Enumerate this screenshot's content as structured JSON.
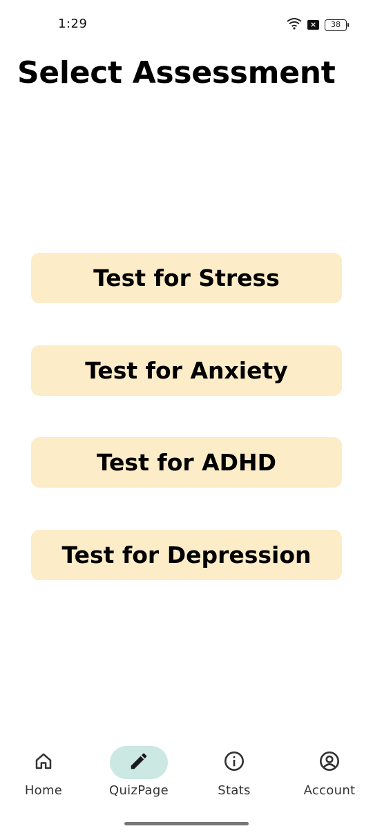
{
  "status_bar": {
    "time": "1:29",
    "battery_level": "38",
    "icons": [
      "wifi-icon",
      "notification-x-icon",
      "battery-icon"
    ]
  },
  "page": {
    "title": "Select Assessment"
  },
  "assessments": [
    {
      "label": "Test for Stress"
    },
    {
      "label": "Test for Anxiety"
    },
    {
      "label": "Test for ADHD"
    },
    {
      "label": "Test for Depression"
    }
  ],
  "nav": {
    "items": [
      {
        "label": "Home",
        "icon": "home-icon",
        "active": false
      },
      {
        "label": "QuizPage",
        "icon": "pencil-icon",
        "active": true
      },
      {
        "label": "Stats",
        "icon": "info-icon",
        "active": false
      },
      {
        "label": "Account",
        "icon": "account-circle-icon",
        "active": false
      }
    ]
  },
  "colors": {
    "button_bg": "#fcecc7",
    "nav_active_bg": "#cce8e2",
    "text": "#000000"
  }
}
